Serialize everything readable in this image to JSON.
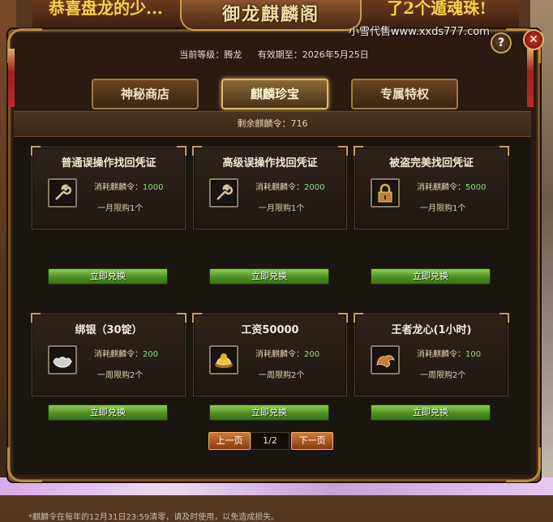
{
  "window": {
    "title": "御龙麒麟阁",
    "banner_left": "恭喜盘龙的少...",
    "banner_right": "了2个遁魂珠!",
    "watermark": "小雪代售www.xxds777.com",
    "help_label": "?",
    "close_label": "✕"
  },
  "status": {
    "level_label": "当前等级：腾龙",
    "expiry_label": "有效期至：2026年5月25日"
  },
  "tabs": [
    {
      "label": "神秘商店",
      "active": false
    },
    {
      "label": "麒麟珍宝",
      "active": true
    },
    {
      "label": "专属特权",
      "active": false
    }
  ],
  "remaining": "剩余麒麟令：716",
  "items": [
    {
      "name": "普通误操作找回凭证",
      "cost_label": "消耗麒麟令：",
      "cost": "1000",
      "limit": "一月限购1个",
      "icon": "wrench-icon",
      "button": "立即兑换"
    },
    {
      "name": "高级误操作找回凭证",
      "cost_label": "消耗麒麟令：",
      "cost": "2000",
      "limit": "一月限购1个",
      "icon": "wrench-icon",
      "button": "立即兑换"
    },
    {
      "name": "被盗完美找回凭证",
      "cost_label": "消耗麒麟令：",
      "cost": "5000",
      "limit": "一月限购1个",
      "icon": "lock-icon",
      "button": "立即兑换"
    },
    {
      "name": "绑银（30锭）",
      "cost_label": "消耗麒麟令：",
      "cost": "200",
      "limit": "一周限购2个",
      "icon": "silver-ingot-icon",
      "button": "立即兑换"
    },
    {
      "name": "工资50000",
      "cost_label": "消耗麒麟令：",
      "cost": "200",
      "limit": "一周限购2个",
      "icon": "gold-ingot-icon",
      "button": "立即兑换"
    },
    {
      "name": "王者龙心(1小时)",
      "cost_label": "消耗麒麟令：",
      "cost": "100",
      "limit": "一周限购2个",
      "icon": "dragon-icon",
      "button": "立即兑换"
    }
  ],
  "note": "*麒麟令在每年的12月31日23:59清零，请及时使用，以免造成损失。",
  "pager": {
    "prev": "上一页",
    "page": "1/2",
    "next": "下一页"
  },
  "colors": {
    "accent_gold": "#c9a060",
    "cost_green": "#8ee07a",
    "button_green": "#4f8f22"
  }
}
